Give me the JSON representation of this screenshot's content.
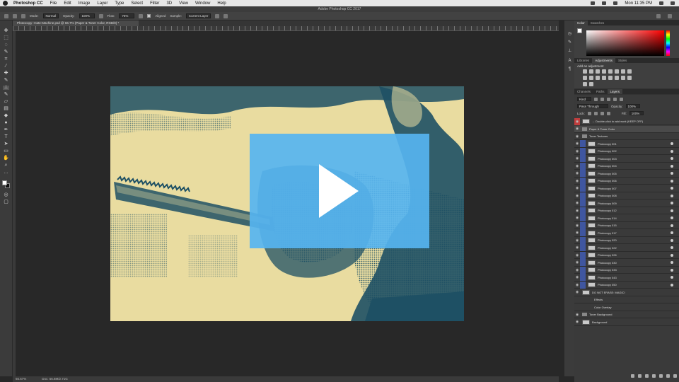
{
  "menubar": {
    "app_name": "Photoshop CC",
    "menus": [
      "File",
      "Edit",
      "Image",
      "Layer",
      "Type",
      "Select",
      "Filter",
      "3D",
      "View",
      "Window",
      "Help"
    ],
    "clock": "Mon 11:35 PM"
  },
  "window": {
    "title": "Adobe Photoshop CC 2017"
  },
  "options": {
    "mode_label": "Mode:",
    "mode_value": "Normal",
    "opacity_label": "Opacity:",
    "opacity_value": "100%",
    "flow_label": "Flow:",
    "flow_value": "75%",
    "aligned_label": "Aligned",
    "sample_label": "Sample:",
    "sample_value": "Current Layer"
  },
  "document_tab": {
    "label": "Photocopy--Hate-Machine.psd @ 66.7% (Paper & Toner Color, RGB/8) *"
  },
  "status": {
    "zoom": "66.67%",
    "doc": "Doc: 56.8M/2.71G"
  },
  "colors": {
    "accent_play": "#56b4f0",
    "paper": "#e9dca0",
    "toner": "#1e5064"
  },
  "panels": {
    "color_tabs": [
      "Color",
      "Swatches"
    ],
    "adjustment_tabs": [
      "Libraries",
      "Adjustments",
      "Styles"
    ],
    "adjustment_title": "Add an adjustment",
    "layer_tabs": [
      "Channels",
      "Paths",
      "Layers"
    ],
    "kind_label": "Kind",
    "blend_mode": "Pass Through",
    "opacity_label": "Opacity:",
    "opacity_value": "100%",
    "lock_label": "Lock:",
    "fill_label": "Fill:",
    "fill_value": "100%"
  },
  "layers": [
    {
      "name": "← Double-click to add work (KEEP OFF)",
      "type": "layer",
      "red": true
    },
    {
      "name": "Paper & Toner Color",
      "type": "group",
      "selected": true
    },
    {
      "name": "Toner Textures",
      "type": "group"
    },
    {
      "name": "Photocopy 001",
      "type": "layer",
      "child": true
    },
    {
      "name": "Photocopy 002",
      "type": "layer",
      "child": true
    },
    {
      "name": "Photocopy 003",
      "type": "layer",
      "child": true
    },
    {
      "name": "Photocopy 004",
      "type": "layer",
      "child": true
    },
    {
      "name": "Photocopy 005",
      "type": "layer",
      "child": true
    },
    {
      "name": "Photocopy 006",
      "type": "layer",
      "child": true
    },
    {
      "name": "Photocopy 007",
      "type": "layer",
      "child": true
    },
    {
      "name": "Photocopy 008",
      "type": "layer",
      "child": true
    },
    {
      "name": "Photocopy 009",
      "type": "layer",
      "child": true
    },
    {
      "name": "Photocopy 012",
      "type": "layer",
      "child": true
    },
    {
      "name": "Photocopy 014",
      "type": "layer",
      "child": true
    },
    {
      "name": "Photocopy 015",
      "type": "layer",
      "child": true
    },
    {
      "name": "Photocopy 017",
      "type": "layer",
      "child": true
    },
    {
      "name": "Photocopy 020",
      "type": "layer",
      "child": true
    },
    {
      "name": "Photocopy 022",
      "type": "layer",
      "child": true
    },
    {
      "name": "Photocopy 026",
      "type": "layer",
      "child": true
    },
    {
      "name": "Photocopy 030",
      "type": "layer",
      "child": true
    },
    {
      "name": "Photocopy 033",
      "type": "layer",
      "child": true
    },
    {
      "name": "Photocopy 043",
      "type": "layer",
      "child": true
    },
    {
      "name": "Photocopy 050",
      "type": "layer",
      "child": true
    },
    {
      "name": "DO NOT ERASE: MAGIC!",
      "type": "layer"
    },
    {
      "name": "Effects",
      "type": "effect"
    },
    {
      "name": "Color Overlay",
      "type": "effect"
    },
    {
      "name": "Toner Background",
      "type": "group"
    },
    {
      "name": "Background",
      "type": "layer"
    }
  ]
}
